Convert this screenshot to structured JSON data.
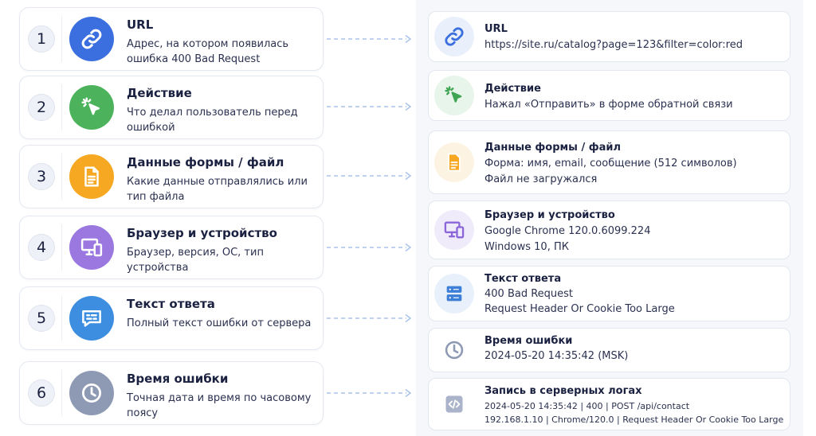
{
  "steps": [
    {
      "num": "1",
      "title": "URL",
      "desc": "Адрес, на котором появилась ошибка 400 Bad Request",
      "icon": "link-icon",
      "color": "#3b6fe0"
    },
    {
      "num": "2",
      "title": "Действие",
      "desc": "Что делал пользователь перед ошибкой",
      "icon": "cursor-click-icon",
      "color": "#4cb35c"
    },
    {
      "num": "3",
      "title": "Данные формы / файл",
      "desc": "Какие данные отправлялись или тип файла",
      "icon": "document-icon",
      "color": "#f6a823"
    },
    {
      "num": "4",
      "title": "Браузер и устройство",
      "desc": "Браузер, версия, ОС, тип устройства",
      "icon": "devices-icon",
      "color": "#9a78e0"
    },
    {
      "num": "5",
      "title": "Текст ответа",
      "desc": "Полный текст ошибки от сервера",
      "icon": "message-icon",
      "color": "#3d8de0"
    },
    {
      "num": "6",
      "title": "Время ошибки",
      "desc": "Точная дата и время по часовому поясу",
      "icon": "clock-icon",
      "color": "#8e9ab4"
    }
  ],
  "examples": [
    {
      "title": "URL",
      "lines": [
        "https://site.ru/catalog?page=123&filter=color:red"
      ],
      "icon": "link-icon"
    },
    {
      "title": "Действие",
      "lines": [
        "Нажал «Отправить» в форме обратной связи"
      ],
      "icon": "cursor-click-icon"
    },
    {
      "title": "Данные формы / файл",
      "lines": [
        "Форма: имя, email, сообщение (512 символов)",
        "Файл не загружался"
      ],
      "icon": "document-icon"
    },
    {
      "title": "Браузер и устройство",
      "lines": [
        "Google Chrome 120.0.6099.224",
        "Windows 10, ПК"
      ],
      "icon": "devices-icon"
    },
    {
      "title": "Текст ответа",
      "lines": [
        "400 Bad Request",
        "Request Header Or Cookie Too Large"
      ],
      "icon": "server-icon"
    },
    {
      "title": "Время ошибки",
      "lines": [
        "2024-05-20 14:35:42 (MSK)"
      ],
      "icon": "clock-icon"
    },
    {
      "title": "Запись в серверных логах",
      "lines": [
        "2024-05-20 14:35:42 | 400 | POST /api/contact",
        "192.168.1.10 | Chrome/120.0 | Request Header Or Cookie Too Large"
      ],
      "icon": "code-icon"
    }
  ],
  "colors": {
    "arrow": "#a9c3ec",
    "panel_bg": "#f5f7fb"
  }
}
